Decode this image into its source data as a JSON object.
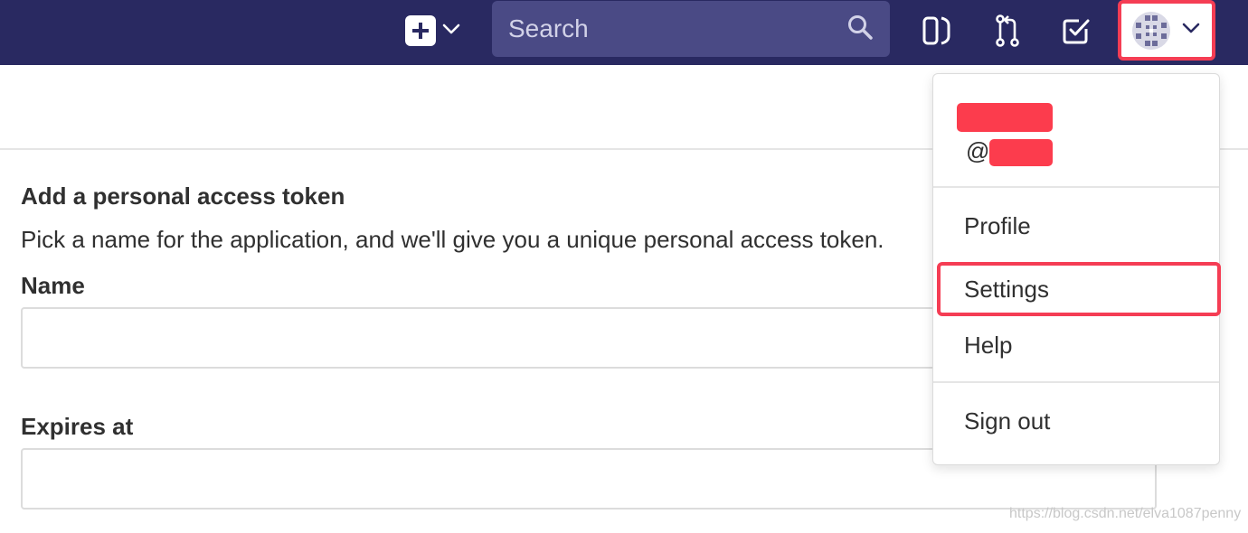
{
  "navbar": {
    "search_placeholder": "Search",
    "icons": [
      "plus-icon",
      "chevron-down-icon",
      "search-icon",
      "issues-icon",
      "merge-request-icon",
      "todo-icon",
      "avatar",
      "chevron-down-icon"
    ],
    "bg_color": "#292961",
    "highlight_color": "#f53d54"
  },
  "form": {
    "title": "Add a personal access token",
    "description": "Pick a name for the application, and we'll give you a unique personal access token.",
    "name_label": "Name",
    "expires_label": "Expires at"
  },
  "dropdown": {
    "at_prefix": "@",
    "items": [
      "Profile",
      "Settings",
      "Help",
      "Sign out"
    ],
    "redaction_color": "#fc3c4d"
  },
  "watermark": "https://blog.csdn.net/elva1087penny"
}
